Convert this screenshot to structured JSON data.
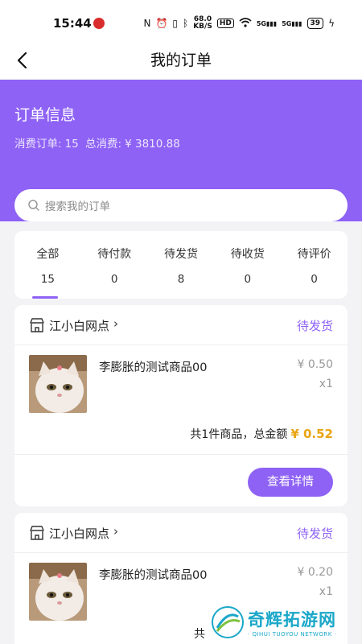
{
  "status_bar": {
    "time": "15:44",
    "speed_value": "68.0",
    "speed_unit": "KB/S",
    "hd": "HD",
    "signal_a": "5G",
    "signal_b": "5G",
    "battery": "39"
  },
  "header": {
    "title": "我的订单"
  },
  "hero": {
    "title": "订单信息",
    "order_count_label": "消费订单:",
    "order_count": "15",
    "total_label": "总消费:",
    "total_value": "¥ 3810.88"
  },
  "search": {
    "placeholder": "搜索我的订单"
  },
  "tabs": [
    {
      "label": "全部",
      "count": "15"
    },
    {
      "label": "待付款",
      "count": "0"
    },
    {
      "label": "待发货",
      "count": "8"
    },
    {
      "label": "待收货",
      "count": "0"
    },
    {
      "label": "待评价",
      "count": "0"
    }
  ],
  "orders": [
    {
      "store": "江小白网点",
      "status": "待发货",
      "product_name": "李膨胀的测试商品00",
      "price": "¥ 0.50",
      "qty": "x1",
      "summary_prefix": "共1件商品，总金额",
      "amount": "¥ 0.52",
      "button": "查看详情"
    },
    {
      "store": "江小白网点",
      "status": "待发货",
      "product_name": "李膨胀的测试商品00",
      "price": "¥ 0.20",
      "qty": "x1",
      "summary_prefix": "共"
    }
  ],
  "watermark": {
    "main": "奇辉拓游网",
    "sub": "· QIHUI TUOYOU NETWORK ·"
  },
  "colors": {
    "accent": "#8e62f5",
    "amount": "#eaa413"
  }
}
